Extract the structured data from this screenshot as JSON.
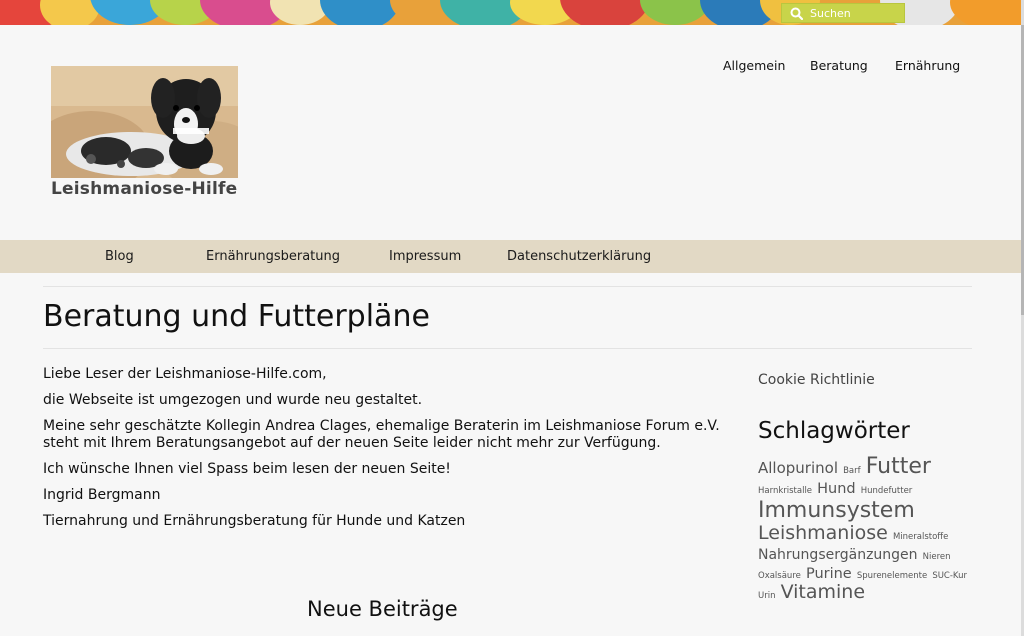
{
  "search": {
    "placeholder": "Suchen"
  },
  "site": {
    "title": "Leishmaniose-Hilfe"
  },
  "topnav": [
    {
      "label": "Allgemein"
    },
    {
      "label": "Beratung"
    },
    {
      "label": "Ernährung"
    }
  ],
  "mainnav": [
    {
      "label": "Blog"
    },
    {
      "label": "Ernährungsberatung"
    },
    {
      "label": "Impressum"
    },
    {
      "label": "Datenschutzerklärung"
    }
  ],
  "page": {
    "title": "Beratung und Futterpläne",
    "paragraphs": [
      "Liebe Leser der Leishmaniose-Hilfe.com,",
      "die Webseite ist umgezogen und wurde neu gestaltet.",
      "Meine sehr geschätzte Kollegin Andrea Clages, ehemalige Beraterin im Leishmaniose Forum e.V. steht mit Ihrem Beratungsangebot auf der neuen Seite leider nicht mehr zur Verfügung.",
      "Ich wünsche Ihnen viel Spass beim lesen der neuen Seite!",
      "Ingrid Bergmann",
      "Tiernahrung und Ernährungsberatung für Hunde und Katzen"
    ],
    "neue_beitraege": "Neue Beiträge"
  },
  "sidebar": {
    "cookie_link": "Cookie Richtlinie",
    "tags_title": "Schlagwörter",
    "tags": [
      "Allopurinol",
      "Barf",
      "Futter",
      "Harnkristalle",
      "Hund",
      "Hundefutter",
      "Immunsystem",
      "Leishmaniose",
      "Mineralstoffe",
      "Nahrungsergänzungen",
      "Nieren",
      "Oxalsäure",
      "Purine",
      "Spurenelemente",
      "SUC-Kur",
      "Urin",
      "Vitamine"
    ]
  },
  "colors": {
    "nav_bar": "#e2d9c5",
    "search_box": "#c8d44a",
    "background": "#f7f7f7"
  },
  "icons": {
    "search": "search-icon"
  }
}
